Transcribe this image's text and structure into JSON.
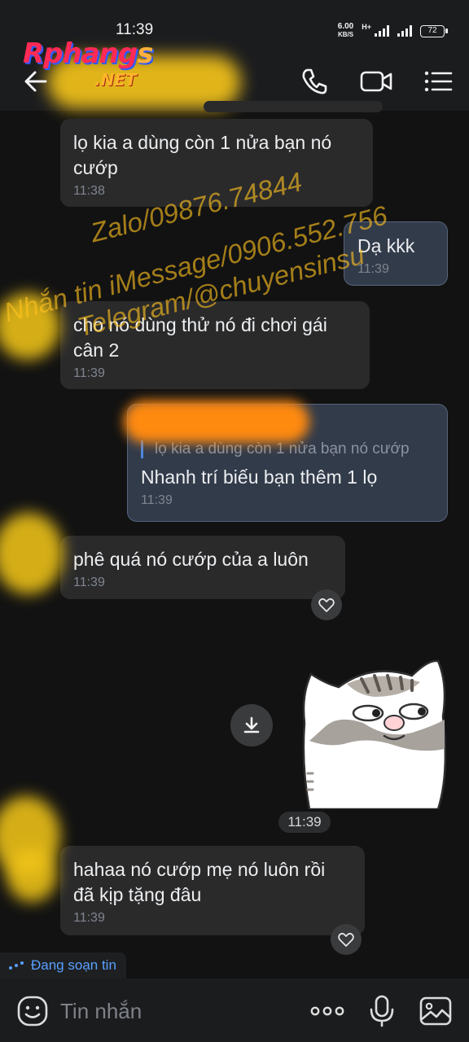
{
  "status_bar": {
    "time": "11:39",
    "net_speed_value": "6.00",
    "net_speed_unit": "KB/S",
    "network": "H+",
    "battery": "72"
  },
  "header": {
    "logo_main": "Rphang",
    "logo_main_accent": "s",
    "logo_sub": ".NET",
    "icons": [
      "back-arrow-icon",
      "phone-icon",
      "video-icon",
      "menu-icon"
    ]
  },
  "messages": [
    {
      "direction": "in",
      "text_line1": "lọ kia a dùng còn 1 nửa bạn nó",
      "text_line2": "cướp",
      "time": "11:38"
    },
    {
      "direction": "out",
      "text_line1": "Dạ kkk",
      "time": "11:39"
    },
    {
      "direction": "in",
      "text_line1": "cho nó dùng thử nó đi chơi gái",
      "text_line2": "cân 2",
      "time": "11:39"
    },
    {
      "direction": "out",
      "quote": "lọ kia a dùng còn 1 nửa bạn nó cướp",
      "text_line1": "Nhanh trí biếu  bạn thêm 1 lọ",
      "time": "11:39"
    },
    {
      "direction": "in",
      "text_line1": "phê quá nó cướp của a luôn",
      "time": "11:39"
    },
    {
      "direction": "out",
      "type": "sticker",
      "time": "11:39"
    },
    {
      "direction": "in",
      "text_line1": "hahaa nó cướp mẹ nó luôn rồi",
      "text_line2": "đã kịp tặng đâu",
      "time": "11:39"
    }
  ],
  "watermark": {
    "line1": "Zalo/09876.74844",
    "line2": "Nhắn tin iMessage/0906.552.756",
    "line3": "Telegram/@chuyensinsu"
  },
  "typing_indicator": "Đang soạn tin",
  "composer": {
    "placeholder": "Tin nhắn",
    "icons": [
      "emoji-icon",
      "more-options-icon",
      "microphone-icon",
      "image-icon"
    ]
  },
  "colors": {
    "background": "#121212",
    "bar": "#1b1c1e",
    "incoming_bubble": "#2a2a2b",
    "outgoing_bubble": "#323b4a",
    "typing_accent": "#58a0ff"
  }
}
